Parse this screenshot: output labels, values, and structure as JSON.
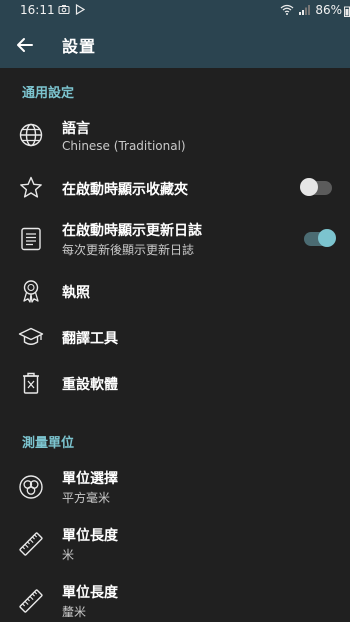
{
  "status_bar": {
    "time": "16:11",
    "battery": "86%"
  },
  "app_bar": {
    "title": "設置"
  },
  "sections": {
    "general": "通用設定",
    "units": "測量單位"
  },
  "items": {
    "language": {
      "label": "語言",
      "sub": "Chinese (Traditional)"
    },
    "favorites": {
      "label": "在啟動時顯示收藏夾",
      "toggle": false
    },
    "changelog": {
      "label": "在啟動時顯示更新日誌",
      "sub": "每次更新後顯示更新日誌",
      "toggle": true
    },
    "license": {
      "label": "執照"
    },
    "translation": {
      "label": "翻譯工具"
    },
    "reset": {
      "label": "重設軟體"
    },
    "unit_select": {
      "label": "單位選擇",
      "sub": "平方毫米"
    },
    "unit_length1": {
      "label": "單位長度",
      "sub": "米"
    },
    "unit_length2": {
      "label": "單位長度",
      "sub": "釐米"
    }
  },
  "colors": {
    "accent": "#7cc4cf",
    "appbar": "#2b4450",
    "background": "#202020"
  }
}
